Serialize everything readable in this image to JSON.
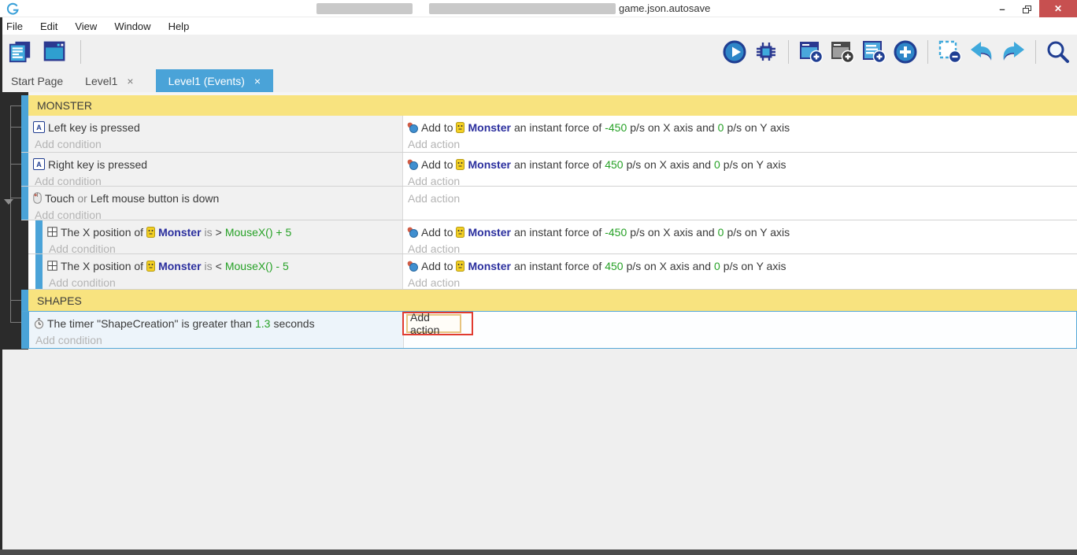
{
  "colors": {
    "accent_blue": "#4aa3d8",
    "section_yellow": "#f8e37f",
    "expression_green": "#26a126",
    "object_navy": "#2b2f9e",
    "close_button_red": "#c75050",
    "annotation_red": "#e13b30",
    "dark_margin": "#2b2b2b"
  },
  "titlebar": {
    "filename": "game.json.autosave"
  },
  "window_controls": {
    "minimize": "–",
    "close": "✕"
  },
  "menu": {
    "file": "File",
    "edit": "Edit",
    "view": "View",
    "window": "Window",
    "help": "Help"
  },
  "toolbar": {
    "left_icons": [
      "project-manager",
      "scene-editor"
    ],
    "right_icons": [
      "preview",
      "debug",
      "add-event",
      "add-comment",
      "add-sub-event",
      "add-other-event",
      "delete-selection",
      "undo",
      "redo",
      "search"
    ]
  },
  "tabs": {
    "start_page": "Start Page",
    "level1": "Level1",
    "events": "Level1 (Events)",
    "close_glyph": "×"
  },
  "sections": {
    "monster": "MONSTER",
    "shapes": "SHAPES"
  },
  "placeholders": {
    "condition": "Add condition",
    "action": "Add action"
  },
  "key_letter": "A",
  "force_action": {
    "add_to": "Add to",
    "object": "Monster",
    "middle": "an instant force of",
    "x_suffix": "p/s on X axis and",
    "y_value": "0",
    "y_suffix": "p/s on Y axis"
  },
  "events": {
    "e1": {
      "condition": "Left key is pressed",
      "x_value": "-450"
    },
    "e2": {
      "condition": "Right key is pressed",
      "x_value": "450"
    },
    "e3": {
      "part1": "Touch",
      "part2": "or",
      "part3": "Left mouse button is down"
    },
    "e4": {
      "part1": "The X position of",
      "object": "Monster",
      "part2": "is",
      "operator": ">",
      "expression": "MouseX() + 5",
      "x_value": "-450"
    },
    "e5": {
      "part1": "The X position of",
      "object": "Monster",
      "part2": "is",
      "operator": "<",
      "expression": "MouseX() - 5",
      "x_value": "450"
    },
    "e6": {
      "part1": "The timer",
      "timer_name": "\"ShapeCreation\"",
      "part2": "is greater than",
      "value": "1.3",
      "part3": "seconds",
      "action_button": "Add action"
    }
  }
}
